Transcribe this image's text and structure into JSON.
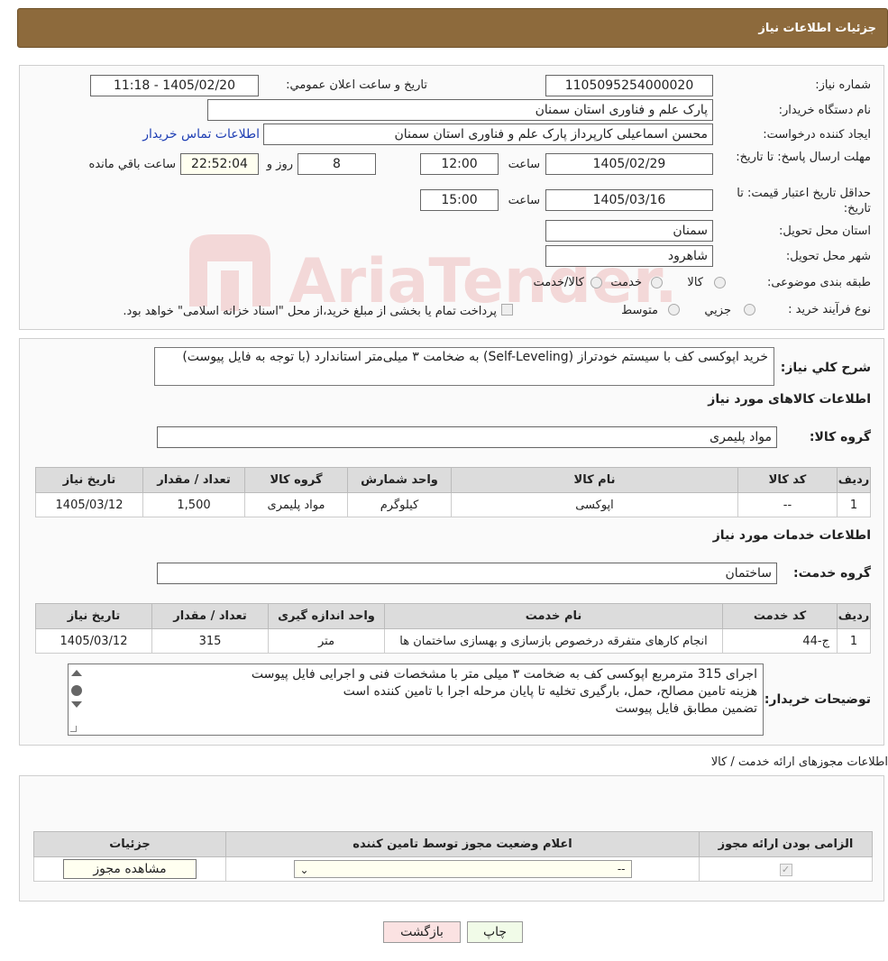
{
  "page_title": "جزئیات اطلاعات نیاز",
  "info": {
    "need_no_label": "شماره نیاز:",
    "need_no": "1105095254000020",
    "announce_label": "تاریخ و ساعت اعلان عمومي:",
    "announce": "1405/02/20 - 11:18",
    "buyer_label": "نام دستگاه خریدار:",
    "buyer": "پارک علم و فناوری استان سمنان",
    "creator_label": "ایجاد کننده درخواست:",
    "creator": "محسن اسماعیلی کارپرداز پارک علم و فناوری استان سمنان",
    "contact_link": "اطلاعات تماس خریدار",
    "deadline_label": "مهلت ارسال پاسخ: تا تاریخ:",
    "deadline_date": "1405/02/29",
    "time_label": "ساعت",
    "deadline_time": "12:00",
    "days": "8",
    "days_label": "روز و",
    "remaining": "22:52:04",
    "remaining_label": "ساعت باقي مانده",
    "validity_label": "حداقل تاریخ اعتبار قیمت: تا تاریخ:",
    "validity_date": "1405/03/16",
    "validity_time": "15:00",
    "province_label": "استان محل تحویل:",
    "province": "سمنان",
    "city_label": "شهر محل تحویل:",
    "city": "شاهرود",
    "category_label": "طبقه بندی موضوعی:",
    "cat_options": [
      "کالا",
      "خدمت",
      "کالا/خدمت"
    ],
    "process_label": "نوع فرآیند خرید :",
    "proc_options": [
      "جزیي",
      "متوسط"
    ],
    "process_note": "پرداخت تمام یا بخشی از مبلغ خرید،از محل \"اسناد خزانه اسلامی\" خواهد بود."
  },
  "desc_label": "شرح کلي نیاز:",
  "desc": "خرید اپوکسی کف با سیستم خودتراز (Self-Leveling) به ضخامت ۳ میلی‌متر استاندارد (با توجه به فایل پیوست)",
  "goods": {
    "title": "اطلاعات کالاهای مورد نیاز",
    "group_label": "گروه کالا:",
    "group": "مواد پلیمری",
    "headers": [
      "ردیف",
      "کد کالا",
      "نام کالا",
      "واحد شمارش",
      "گروه کالا",
      "تعداد / مقدار",
      "تاریخ نیاز"
    ],
    "row": [
      "1",
      "--",
      "اپوکسی",
      "کیلوگرم",
      "مواد پلیمری",
      "1,500",
      "1405/03/12"
    ]
  },
  "services": {
    "title": "اطلاعات خدمات مورد نیاز",
    "group_label": "گروه خدمت:",
    "group": "ساختمان",
    "headers": [
      "ردیف",
      "کد خدمت",
      "نام خدمت",
      "واحد اندازه گیری",
      "تعداد / مقدار",
      "تاریخ نیاز"
    ],
    "row": [
      "1",
      "ج-44",
      "انجام کارهای متفرقه درخصوص بازسازی و بهسازی ساختمان ها",
      "متر",
      "315",
      "1405/03/12"
    ]
  },
  "buyer_notes_label": "توضیحات خریدار:",
  "buyer_notes": [
    "اجرای 315 مترمربع اپوکسی کف به ضخامت ۳ میلی متر با مشخصات فنی و اجرایی فایل پیوست",
    "هزینه تامین مصالح، حمل، بارگیری  تخلیه تا پایان مرحله اجرا با تامین کننده است",
    "تضمین مطابق فایل پیوست"
  ],
  "permits": {
    "title": "اطلاعات مجوزهای ارائه خدمت / کالا",
    "headers": [
      "الزامی بودن ارائه مجوز",
      "اعلام وضعیت مجوز توسط تامین کننده",
      "جزئیات"
    ],
    "select_value": "--",
    "view_button": "مشاهده مجوز"
  },
  "buttons": {
    "print": "چاپ",
    "back": "بازگشت"
  },
  "watermark": "AriaTender.neT"
}
